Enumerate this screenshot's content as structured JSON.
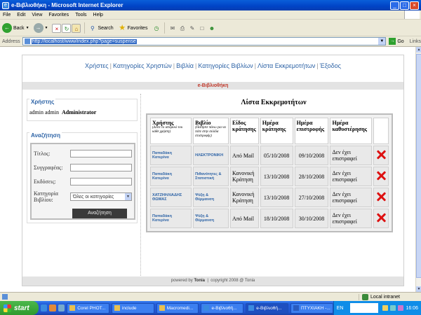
{
  "window": {
    "title": "e-Βιβλιοθήκη - Microsoft Internet Explorer",
    "icon_glyph": "e",
    "min": "_",
    "max": "□",
    "close": "×"
  },
  "menu": [
    "File",
    "Edit",
    "View",
    "Favorites",
    "Tools",
    "Help"
  ],
  "toolbar": {
    "back": "Back",
    "search": "Search",
    "favorites": "Favorites"
  },
  "address": {
    "label": "Address",
    "url": "http://localhost/www/index.php?page=suspense",
    "go": "Go",
    "links": "Links"
  },
  "site": {
    "nav": [
      "Χρήστες",
      "Κατηγορίες Χρηστών",
      "Βιβλία",
      "Κατηγορίες Βιβλίων",
      "Λίστα Εκκρεμοτήτων",
      "Έξοδος"
    ],
    "brand": "e-Βιβλιοθήκη",
    "user_panel": {
      "legend": "Χρήστης",
      "user": "admin  admin",
      "role": "Administrator"
    },
    "search_panel": {
      "legend": "Αναζήτηση",
      "title_label": "Τίτλος:",
      "author_label": "Συγγραφέας:",
      "publisher_label": "Εκδόσεις:",
      "category_label_1": "Κατηγορία",
      "category_label_2": "Βιβλίου:",
      "category_value": "Όλες οι κατηγορίες",
      "button": "Αναζήτηση"
    },
    "list": {
      "title": "Λίστα Εκκρεμοτήτων",
      "headers": {
        "user": "Χρήστης",
        "user_sub": "(Δείτε το ιστορικό του κάθε χρήστη)",
        "book": "Βιβλίο",
        "book_sub": "(Πατήστε πάνω για να πάτε στην σελίδα επιστροφής)",
        "type": "Είδος κράτησης",
        "res_date": "Ημέρα κράτησης",
        "ret_date": "Ημέρα επιστροφής",
        "delay": "Ημέρα καθυστέρησης"
      },
      "rows": [
        {
          "user": "Παπαδάκη Κατερίνα",
          "book": "ΗΛΕΚΤΡΟΝΙΚΗ",
          "type": "Από Mail",
          "res": "05/10/2008",
          "ret": "09/10/2008",
          "delay": "Δεν έχει επιστραφεί"
        },
        {
          "user": "Παπαδάκη Κατερίνα",
          "book": "Πιθανότητες & Στατιστική",
          "type": "Κανονική Κράτηση",
          "res": "13/10/2008",
          "ret": "28/10/2008",
          "delay": "Δεν έχει επιστραφεί"
        },
        {
          "user": "ΧΑΤΖΗΗΛΙΑΔΗΣ ΘΩΜΑΣ",
          "book": "Ψύξη & Θέρμανση",
          "type": "Κανονική Κράτηση",
          "res": "13/10/2008",
          "ret": "27/10/2008",
          "delay": "Δεν έχει επιστραφεί"
        },
        {
          "user": "Παπαδάκη Κατερίνα",
          "book": "Ψύξη & Θέρμανση",
          "type": "Από Mail",
          "res": "18/10/2008",
          "ret": "30/10/2008",
          "delay": "Δεν έχει επιστραφεί"
        }
      ]
    },
    "footer": {
      "powered": "powered by",
      "author": "Tonia",
      "copy": "copyright 2008 @ Tonia"
    }
  },
  "status": {
    "zone": "Local intranet"
  },
  "taskbar": {
    "start": "start",
    "tasks": [
      "Corel PHOT...",
      "include",
      "Macromedi...",
      "e-Βιβλιοθή...",
      "e-Βιβλιοθή...",
      "ΠΤΥΧΙΑΚΗ -..."
    ],
    "lang": "EN",
    "clock": "16:06"
  }
}
